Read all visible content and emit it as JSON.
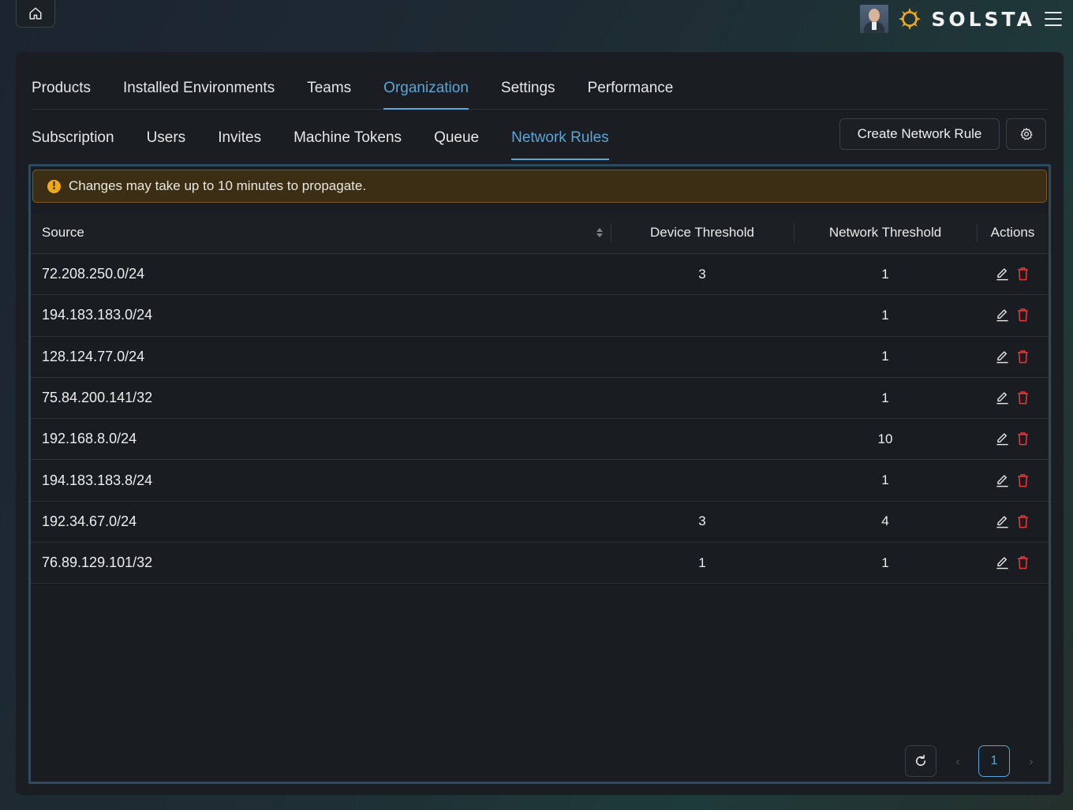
{
  "topbar": {
    "brand": "SOLSTA",
    "colors": {
      "accent": "#5ba5d9",
      "sun": "#f0a81c",
      "delete": "#e23a3a",
      "warning_bg": "#3b2e14"
    }
  },
  "tabs_primary": [
    {
      "label": "Products"
    },
    {
      "label": "Installed Environments"
    },
    {
      "label": "Teams"
    },
    {
      "label": "Organization",
      "active": true
    },
    {
      "label": "Settings"
    },
    {
      "label": "Performance"
    }
  ],
  "tabs_secondary": [
    {
      "label": "Subscription"
    },
    {
      "label": "Users"
    },
    {
      "label": "Invites"
    },
    {
      "label": "Machine Tokens"
    },
    {
      "label": "Queue"
    },
    {
      "label": "Network Rules",
      "active": true
    }
  ],
  "toolbar": {
    "create_label": "Create Network Rule"
  },
  "alert": {
    "message": "Changes may take up to 10 minutes to propagate."
  },
  "table": {
    "headers": {
      "source": "Source",
      "device": "Device Threshold",
      "network": "Network Threshold",
      "actions": "Actions"
    },
    "rows": [
      {
        "source": "72.208.250.0/24",
        "device": "3",
        "network": "1"
      },
      {
        "source": "194.183.183.0/24",
        "device": "",
        "network": "1"
      },
      {
        "source": "128.124.77.0/24",
        "device": "",
        "network": "1"
      },
      {
        "source": "75.84.200.141/32",
        "device": "",
        "network": "1"
      },
      {
        "source": "192.168.8.0/24",
        "device": "",
        "network": "10"
      },
      {
        "source": "194.183.183.8/24",
        "device": "",
        "network": "1"
      },
      {
        "source": "192.34.67.0/24",
        "device": "3",
        "network": "4"
      },
      {
        "source": "76.89.129.101/32",
        "device": "1",
        "network": "1"
      }
    ]
  },
  "pagination": {
    "current": "1",
    "prev": "‹",
    "next": "›"
  }
}
